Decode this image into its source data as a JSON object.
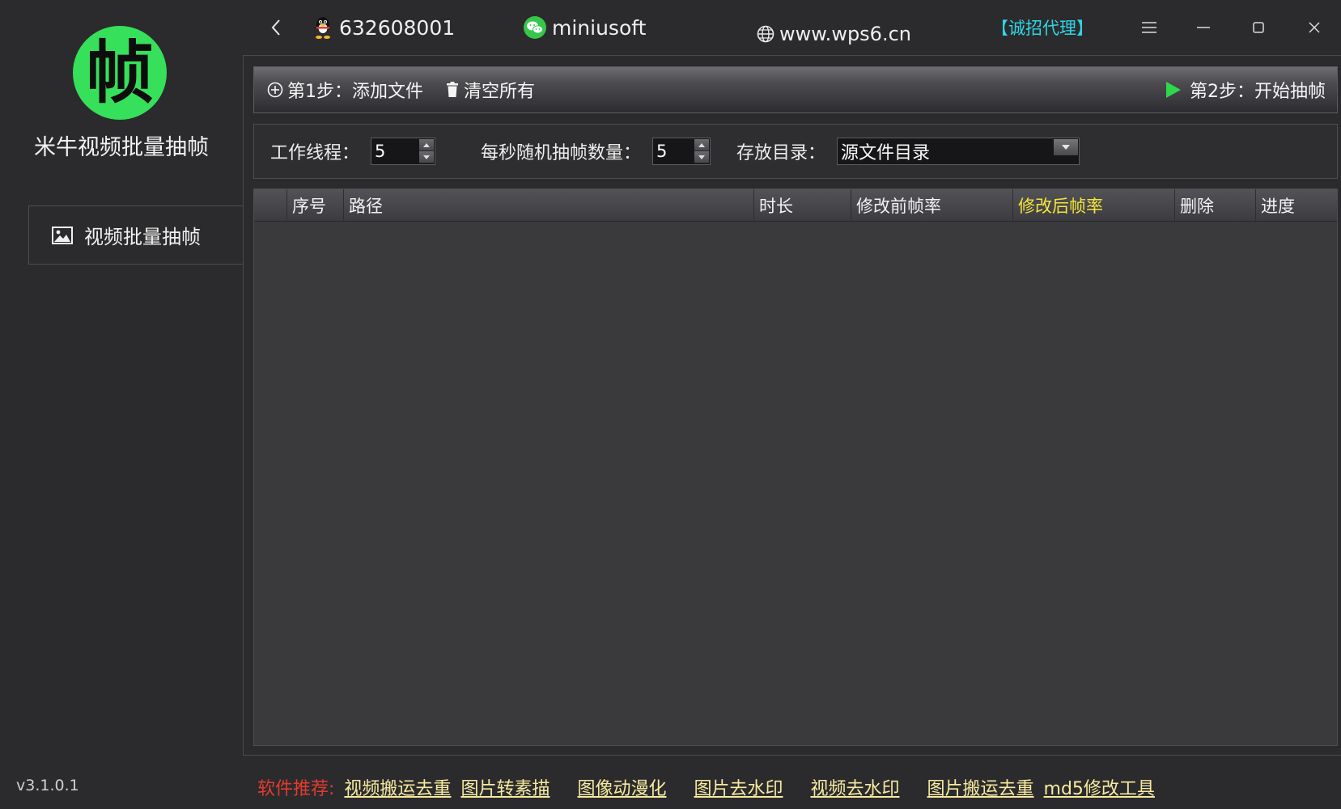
{
  "app": {
    "logo_char": "帧",
    "title": "米牛视频批量抽帧",
    "version": "v3.1.0.1"
  },
  "sidebar": {
    "items": [
      {
        "label": "视频批量抽帧",
        "icon": "image-icon"
      }
    ]
  },
  "titlebar": {
    "qq_number": "632608001",
    "wechat_id": "miniusoft",
    "website": "www.wps6.cn",
    "agent_link": "【诚招代理】"
  },
  "toolbar": {
    "add_files_label": "第1步：添加文件",
    "clear_all_label": "清空所有",
    "start_label": "第2步：开始抽帧"
  },
  "settings": {
    "threads_label": "工作线程：",
    "threads_value": "5",
    "frames_label": "每秒随机抽帧数量：",
    "frames_value": "5",
    "output_label": "存放目录：",
    "output_value": "源文件目录"
  },
  "table": {
    "columns": [
      "序号",
      "路径",
      "时长",
      "修改前帧率",
      "修改后帧率",
      "删除",
      "进度"
    ],
    "rows": []
  },
  "footer": {
    "recommend_label": "软件推荐:",
    "links": [
      "视频搬运去重",
      "图片转素描",
      "图像动漫化",
      "图片去水印",
      "视频去水印",
      "图片搬运去重",
      "md5修改工具"
    ]
  },
  "colors": {
    "logo_green": "#36e05a",
    "agent_cyan": "#2fd6e6",
    "start_green": "#2ed84a",
    "highlight_yellow": "#f5e63a",
    "recommend_red": "#e23b2e",
    "link_cream": "#f7eaa0"
  }
}
